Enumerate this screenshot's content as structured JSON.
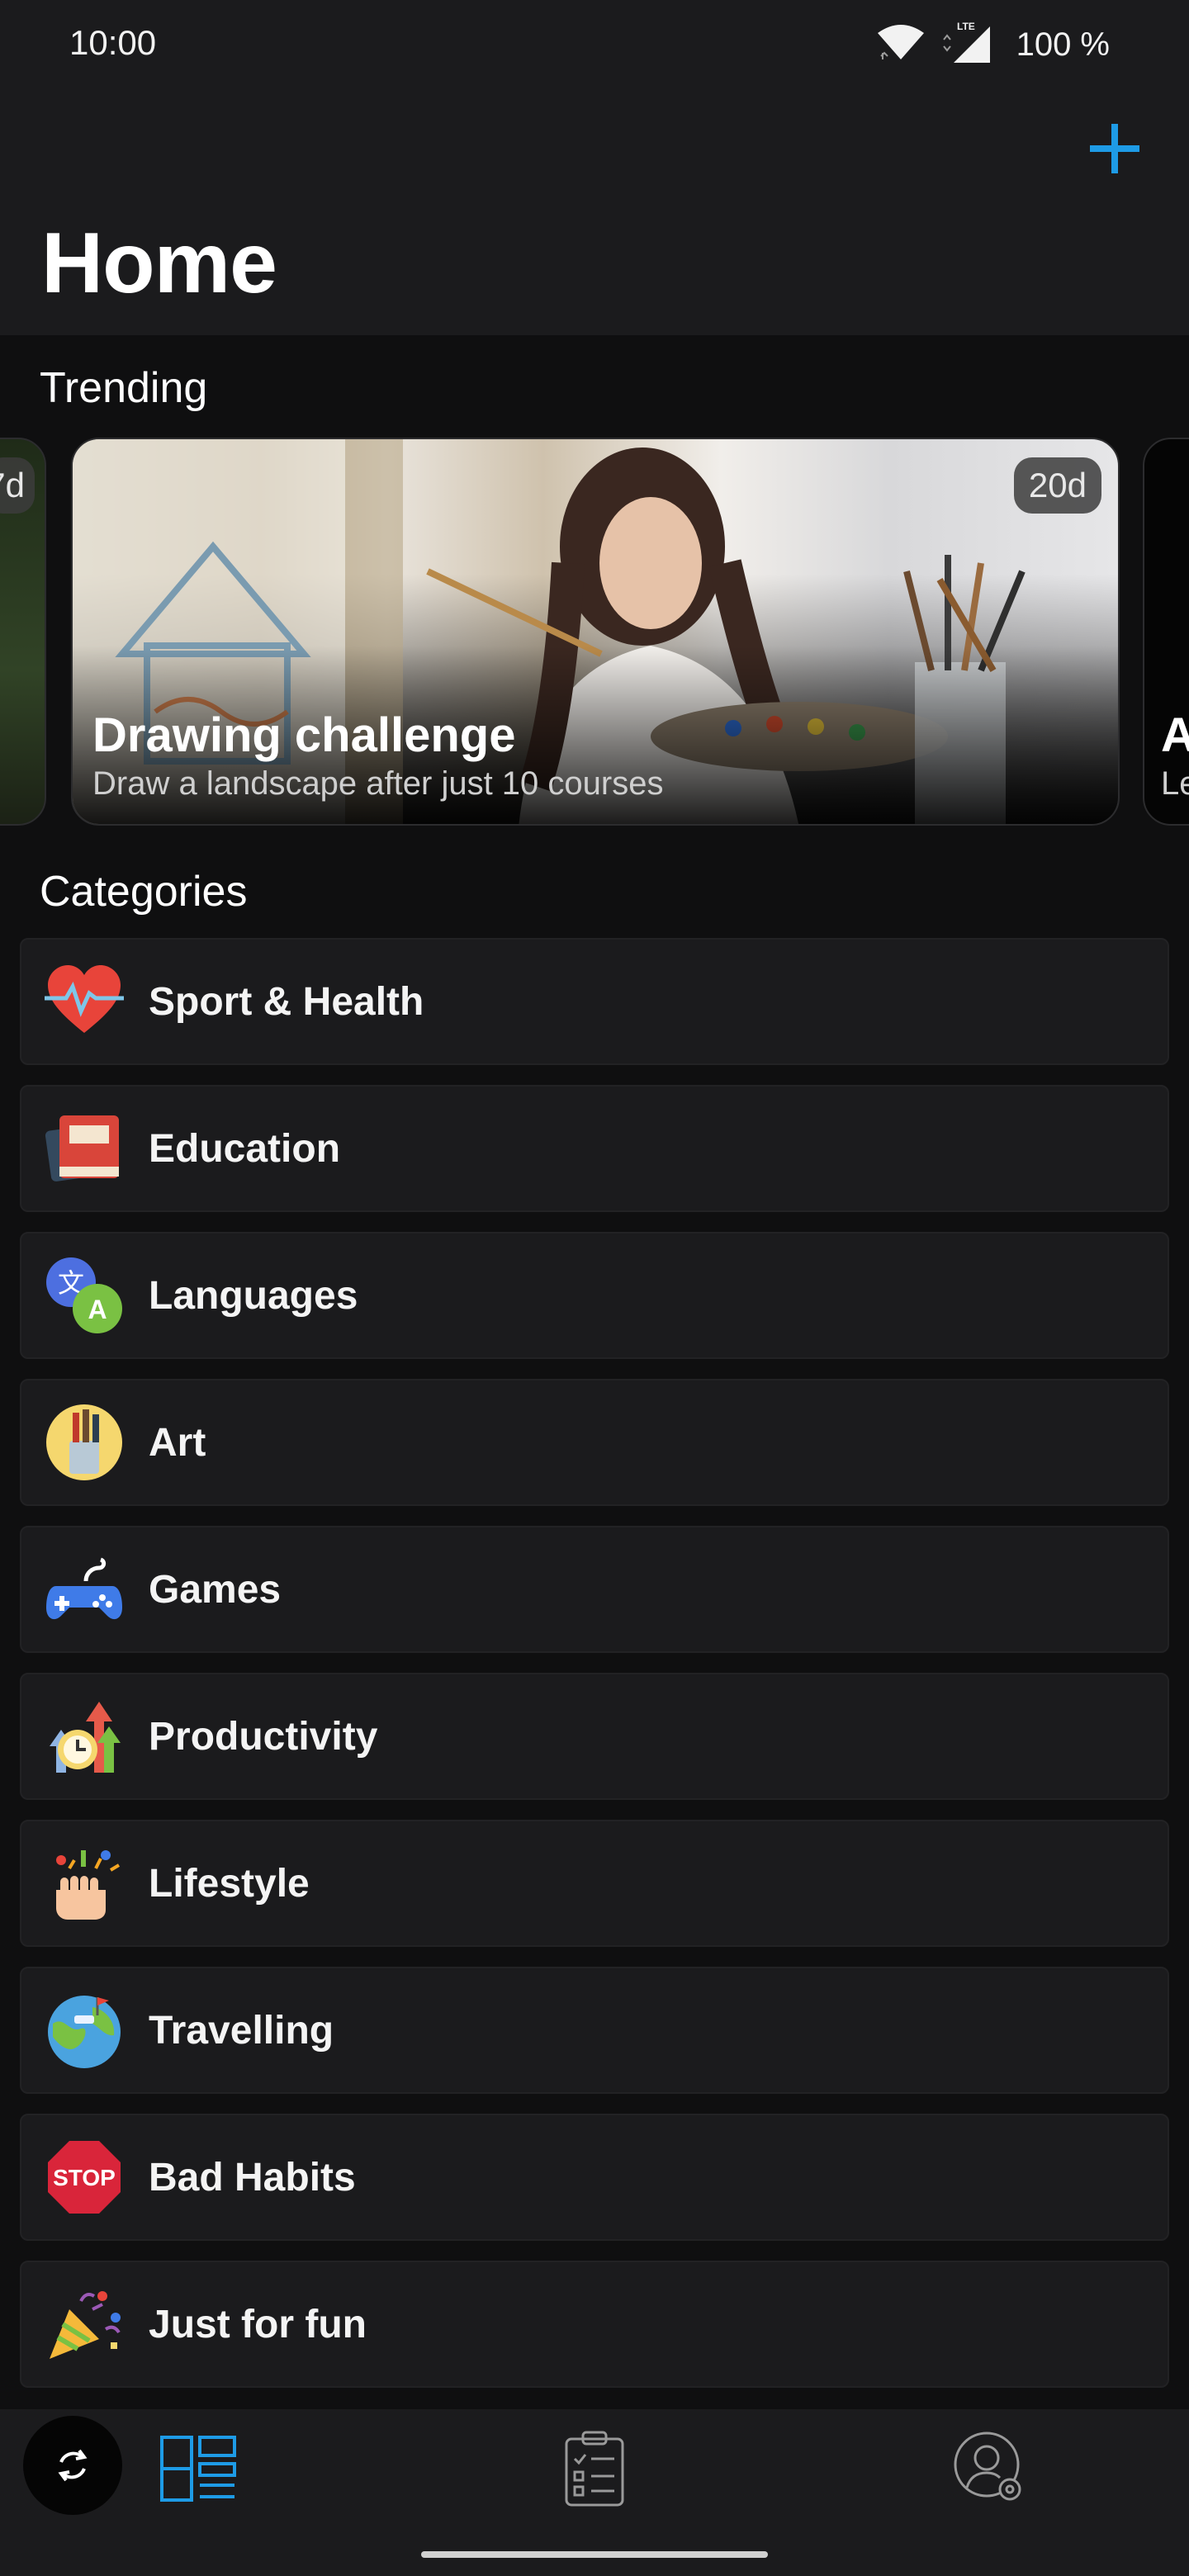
{
  "status_bar": {
    "time": "10:00",
    "network": "LTE",
    "battery": "100 %"
  },
  "header": {
    "title": "Home",
    "add_icon": "plus-icon",
    "accent_color": "#1e9be6"
  },
  "trending": {
    "title": "Trending",
    "prev_card": {
      "badge": "7d"
    },
    "main_card": {
      "badge": "20d",
      "title": "Drawing challenge",
      "subtitle": "Draw a landscape after just 10 courses"
    },
    "next_card": {
      "title": "A",
      "subtitle": "Le"
    }
  },
  "categories": {
    "title": "Categories",
    "items": [
      {
        "label": "Sport & Health",
        "icon": "heart-pulse-icon"
      },
      {
        "label": "Education",
        "icon": "book-icon"
      },
      {
        "label": "Languages",
        "icon": "translate-icon"
      },
      {
        "label": "Art",
        "icon": "paint-brushes-icon"
      },
      {
        "label": "Games",
        "icon": "gamepad-icon"
      },
      {
        "label": "Productivity",
        "icon": "clock-arrows-icon"
      },
      {
        "label": "Lifestyle",
        "icon": "confetti-hand-icon"
      },
      {
        "label": "Travelling",
        "icon": "globe-icon"
      },
      {
        "label": "Bad Habits",
        "icon": "stop-sign-icon",
        "icon_text": "STOP"
      },
      {
        "label": "Just for fun",
        "icon": "party-popper-icon"
      }
    ]
  },
  "bottom_nav": {
    "items": [
      {
        "icon": "refresh-icon"
      },
      {
        "icon": "dashboard-icon",
        "active": true
      },
      {
        "icon": "clipboard-checklist-icon"
      },
      {
        "icon": "profile-settings-icon"
      }
    ]
  }
}
